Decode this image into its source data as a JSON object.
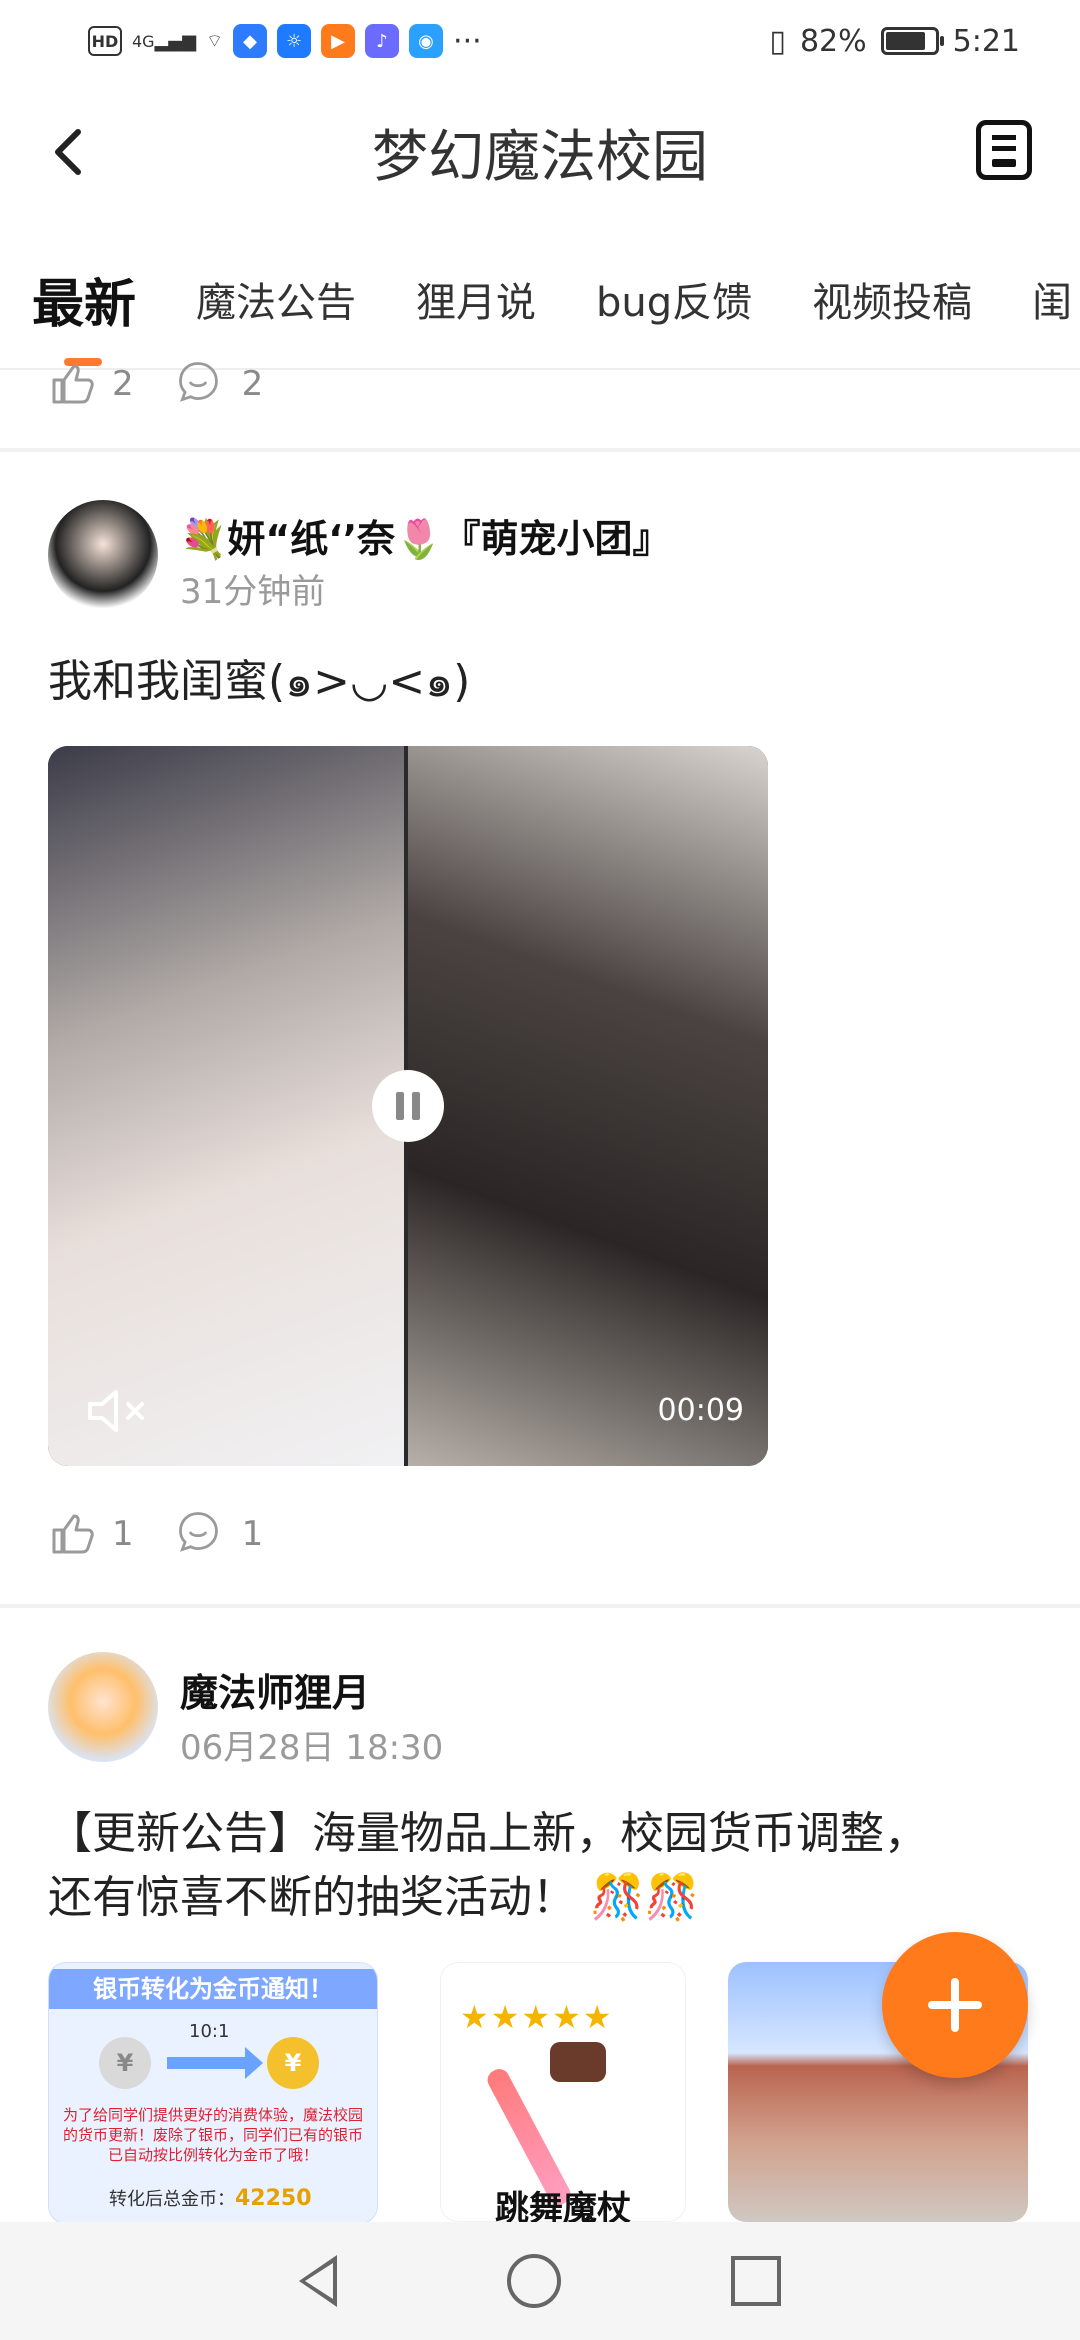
{
  "status_bar": {
    "hd": "HD",
    "net": "4G",
    "battery_percent": "82%",
    "battery_level": 0.82,
    "time": "5:21",
    "more": "···"
  },
  "header": {
    "title": "梦幻魔法校园"
  },
  "tabs": [
    "最新",
    "魔法公告",
    "狸月说",
    "bug反馈",
    "视频投稿",
    "闺"
  ],
  "prev_post": {
    "likes": "2",
    "comments": "2"
  },
  "post1": {
    "author": "💐妍“纸‘’奈🌷『萌宠小团』",
    "time": "31分钟前",
    "text": "我和我闺蜜(๑>◡<๑)",
    "video_duration": "00:09",
    "likes": "1",
    "comments": "1"
  },
  "post2": {
    "author": "魔法师狸月",
    "time": "06月28日 18:30",
    "text_line1": "【更新公告】海量物品上新，校园货币调整，",
    "text_line2": "还有惊喜不断的抽奖活动！ 🎊🎊",
    "image1": {
      "title": "银币转化为金币通知！",
      "ratio": "10:1",
      "note": "为了给同学们提供更好的消费体验，魔法校园的货币更新！废除了银币，同学们已有的银币已自动按比例转化为金币了哦！",
      "gold_label": "转化后总金币：",
      "gold_value": "42250"
    },
    "image2": {
      "stars": "★★★★★",
      "label": "跳舞魔杖"
    }
  }
}
